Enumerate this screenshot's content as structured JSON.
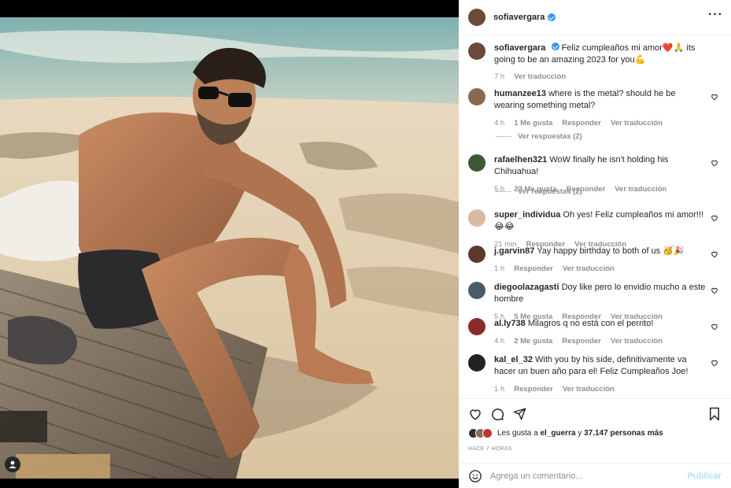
{
  "post": {
    "username": "sofiavergara",
    "verified": true,
    "more_icon": "more-horizontal-icon",
    "caption_user": "sofiavergara",
    "caption_text": "Feliz cumpleaños mi amor❤️🙏 its going to be an amazing 2023 for you💪",
    "caption_time": "7 h",
    "caption_translate": "Ver traducción"
  },
  "comments": [
    {
      "user": "humanzee13",
      "text": "where is the metal? should he be wearing something metal?",
      "time": "4 h",
      "likes": "1 Me gusta",
      "reply": "Responder",
      "translate": "Ver traducción",
      "avatar_color": "#8a6a4c"
    },
    {
      "user": "rafaelhen321",
      "text": "WoW finally he isn't holding his Chihuahua!",
      "time": "5 h",
      "likes": "23 Me gusta",
      "reply": "Responder",
      "translate": "Ver traducción",
      "avatar_color": "#3b5a33"
    },
    {
      "user": "super_individua",
      "text": "Oh yes! Feliz cumpleaños mi amor!!! 😂😂",
      "time": "21 min",
      "likes": "",
      "reply": "Responder",
      "translate": "Ver traducción",
      "avatar_color": "#d9b8a4"
    },
    {
      "user": "j.garvin87",
      "text": "Yay happy birthday to both of us 🥳🎉",
      "time": "1 h",
      "likes": "",
      "reply": "Responder",
      "translate": "Ver traducción",
      "avatar_color": "#5b3a2c"
    },
    {
      "user": "diegoolazagasti",
      "text": "Doy like pero lo envidio mucho a este hombre",
      "time": "5 h",
      "likes": "5 Me gusta",
      "reply": "Responder",
      "translate": "Ver traducción",
      "avatar_color": "#4a5a66"
    },
    {
      "user": "al.ly738",
      "text": "Milagros q no está con el perrito!",
      "time": "4 h",
      "likes": "2 Me gusta",
      "reply": "Responder",
      "translate": "Ver traducción",
      "avatar_color": "#8a2b2b"
    },
    {
      "user": "kal_el_32",
      "text": "With you by his side, definitivamente va hacer un buen año para el! Feliz Cumpleaños Joe!",
      "time": "1 h",
      "likes": "",
      "reply": "Responder",
      "translate": "Ver traducción",
      "avatar_color": "#222222"
    }
  ],
  "replies": [
    {
      "label": "Ver respuestas (2)"
    },
    {
      "label": "Ver respuestas (2)"
    }
  ],
  "actions": {
    "like_icon": "heart-icon",
    "comment_icon": "comment-icon",
    "share_icon": "send-icon",
    "save_icon": "bookmark-icon"
  },
  "likes": {
    "prefix": "Les gusta a",
    "user": "el_guerra",
    "joiner": "y",
    "count": "37.147 personas más"
  },
  "timestamp": "HACE 7 HORAS",
  "composer": {
    "placeholder": "Agrega un comentario...",
    "publish_label": "Publicar",
    "emoji_icon": "smiley-icon"
  },
  "colors": {
    "verified": "#3897f0",
    "publish": "#b2dffc",
    "muted": "#8e8e8e",
    "text": "#262626"
  }
}
